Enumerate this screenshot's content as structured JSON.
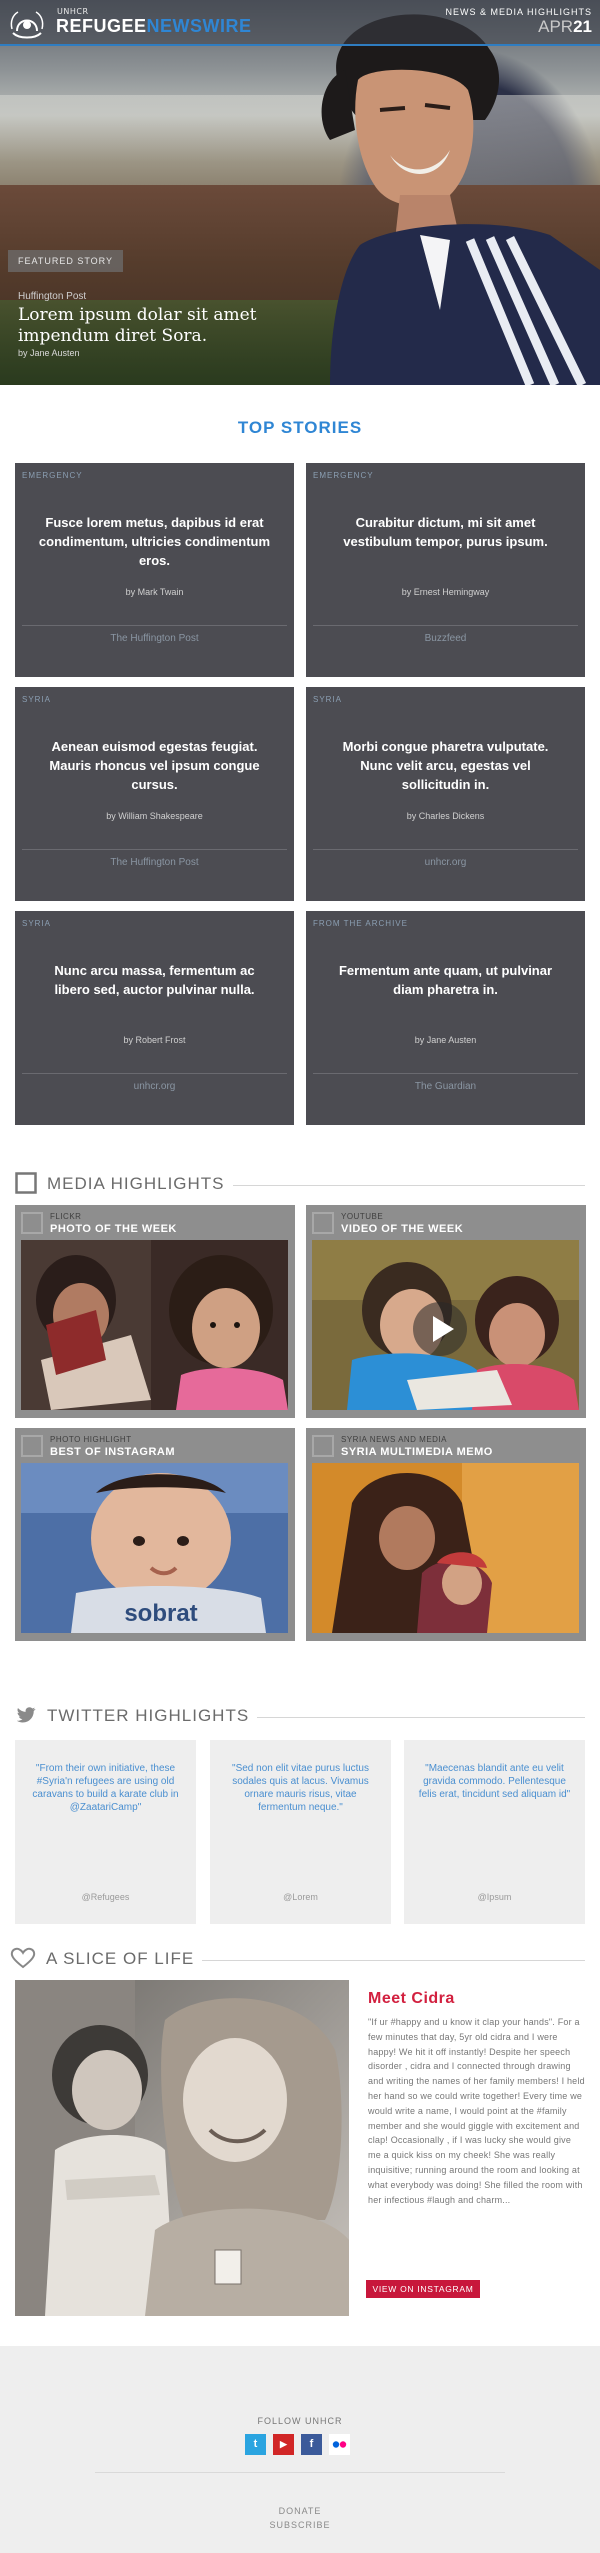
{
  "header": {
    "org_small": "UNHCR",
    "logo_part1": "REFUGEE",
    "logo_part2": "NEWSWIRE",
    "subtitle": "NEWS & MEDIA HIGHLIGHTS",
    "date_month": "APR",
    "date_day": "21"
  },
  "featured": {
    "badge": "FEATURED STORY",
    "source": "Huffington Post",
    "title": "Lorem ipsum dolar sit amet impendum diret Sora.",
    "author": "by Jane Austen"
  },
  "top_stories": {
    "heading": "TOP STORIES",
    "cards": [
      {
        "category": "EMERGENCY",
        "title": "Fusce lorem metus, dapibus id erat condimentum, ultricies condimentum eros.",
        "byline": "by Mark Twain",
        "source": "The Huffington Post"
      },
      {
        "category": "EMERGENCY",
        "title": "Curabitur dictum, mi sit amet vestibulum tempor, purus ipsum.",
        "byline": "by Ernest Hemingway",
        "source": "Buzzfeed"
      },
      {
        "category": "SYRIA",
        "title": "Aenean euismod egestas feugiat. Mauris rhoncus vel ipsum congue cursus.",
        "byline": "by William Shakespeare",
        "source": "The Huffington Post"
      },
      {
        "category": "SYRIA",
        "title": "Morbi congue pharetra vulputate. Nunc velit arcu, egestas vel sollicitudin in.",
        "byline": "by Charles Dickens",
        "source": "unhcr.org"
      },
      {
        "category": "SYRIA",
        "title": "Nunc arcu massa, fermentum ac libero sed, auctor pulvinar nulla.",
        "byline": "by Robert Frost",
        "source": "unhcr.org"
      },
      {
        "category": "FROM THE ARCHIVE",
        "title": "Fermentum ante quam, ut pulvinar diam pharetra in.",
        "byline": "by Jane Austen",
        "source": "The Guardian"
      }
    ]
  },
  "media": {
    "heading": "MEDIA HIGHLIGHTS",
    "items": [
      {
        "source": "FLICKR",
        "title": "PHOTO OF THE WEEK"
      },
      {
        "source": "YOUTUBE",
        "title": "VIDEO OF THE WEEK"
      },
      {
        "source": "PHOTO HIGHLIGHT",
        "title": "BEST OF INSTAGRAM",
        "image_text": "sobrat"
      },
      {
        "source": "SYRIA NEWS AND MEDIA",
        "title": "SYRIA MULTIMEDIA MEMO"
      }
    ]
  },
  "twitter": {
    "heading": "TWITTER HIGHLIGHTS",
    "tweets": [
      {
        "text": "\"From their own initiative, these #Syria'n refugees are using old caravans to build a karate club in @ZaatariCamp\"",
        "handle": "@Refugees"
      },
      {
        "text": "\"Sed non elit vitae purus luctus sodales quis at lacus. Vivamus ornare mauris risus, vitae fermentum neque.\"",
        "handle": "@Lorem"
      },
      {
        "text": "\"Maecenas blandit ante eu velit gravida commodo. Pellentesque felis erat, tincidunt sed aliquam id\"",
        "handle": "@Ipsum"
      }
    ]
  },
  "slice": {
    "heading": "A SLICE OF LIFE",
    "name": "Meet Cidra",
    "body": "\"If ur #happy and u know it clap your hands\". For a few minutes that day, 5yr old cidra and I were happy! We hit it off instantly! Despite her speech disorder , cidra and I connected through drawing and writing the names of her family members! I held her hand so we could write together! Every time we would write a name, I would point at the #family member and she would giggle with excitement and clap! Occasionally , if I was lucky she would give me a quick kiss on my cheek! She was really inquisitive; running around the room and looking at what everybody was doing! She filled the room with her infectious #laugh and charm...",
    "button": "VIEW ON INSTAGRAM"
  },
  "footer": {
    "follow": "FOLLOW UNHCR",
    "social": [
      {
        "name": "twitter",
        "glyph": "t",
        "color": "#2aa4e0"
      },
      {
        "name": "youtube",
        "glyph": "▶",
        "color": "#d12626"
      },
      {
        "name": "facebook",
        "glyph": "f",
        "color": "#3b5a9a"
      },
      {
        "name": "flickr",
        "glyph": "●●",
        "color": "#ffffff"
      }
    ],
    "donate": "DONATE",
    "subscribe": "SUBSCRIBE"
  },
  "colors": {
    "accent_blue": "#2f86d4",
    "card_bg": "#4c4c52",
    "instagram_red": "#c8173b"
  }
}
